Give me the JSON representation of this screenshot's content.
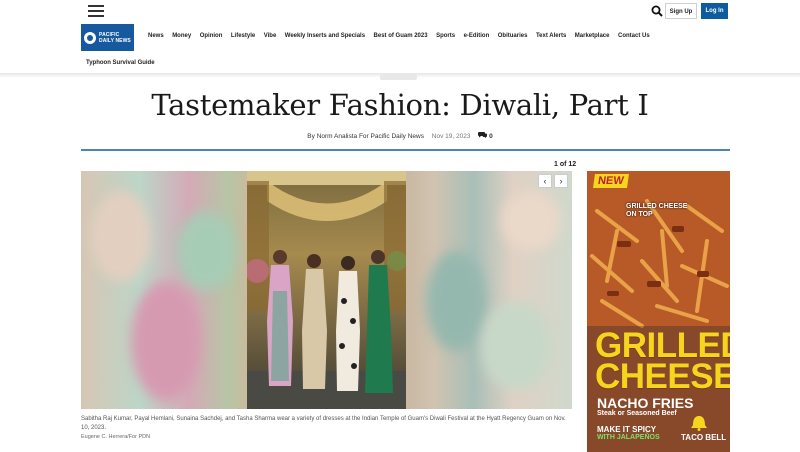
{
  "header": {
    "signup_label": "Sign Up",
    "login_label": "Log In",
    "logo_text": "PACIFIC DAILY NEWS"
  },
  "nav": {
    "items": [
      "News",
      "Money",
      "Opinion",
      "Lifestyle",
      "Vibe",
      "Weekly Inserts and Specials",
      "Best of Guam 2023",
      "Sports",
      "e-Edition",
      "Obituaries",
      "Text Alerts",
      "Marketplace",
      "Contact Us"
    ],
    "secondary": "Typhoon Survival Guide"
  },
  "article": {
    "section": "",
    "title": "Tastemaker Fashion: Diwali, Part I",
    "byline": "By Norm Analista For Pacific Daily News",
    "date": "Nov 19, 2023",
    "comments": "0"
  },
  "gallery": {
    "counter": "1 of 12",
    "prev_label": "‹",
    "next_label": "›",
    "caption": "Sabitha Raj Kumar, Payal Hemlani, Sunaina Sachdej, and Tasha Sharma wear a variety of dresses at the Indian Temple of Guam's Diwali Festival at the Hyatt Regency Guam on Nov. 10, 2023.",
    "credit": "Eugene C. Herrera/For PDN"
  },
  "ad": {
    "badge": "NEW",
    "top_text_1": "GRILLED CHEESE",
    "top_text_2": "ON TOP",
    "big_1": "GRILLED",
    "big_2": "CHEESE",
    "sub": "NACHO FRIES",
    "sub2": "Steak or Seasoned Beef",
    "spicy_1": "MAKE IT SPICY",
    "spicy_2": "WITH JALAPEÑOS",
    "brand": "TACO BELL"
  },
  "colors": {
    "accent": "#0e5c9e",
    "logo": "#17599e",
    "divider": "#4a86b3",
    "ad_yellow": "#f5d51e"
  }
}
